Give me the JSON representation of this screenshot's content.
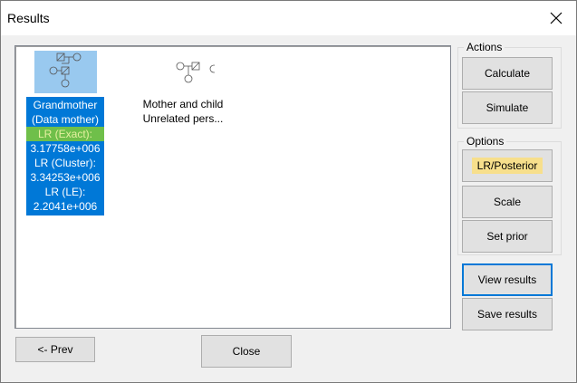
{
  "window": {
    "title": "Results"
  },
  "results_list": {
    "items": [
      {
        "lines": [
          "Grandmother",
          "(Data mother)",
          "LR (Exact):",
          "3.17758e+006",
          "LR (Cluster):",
          "3.34253e+006",
          "LR (LE):",
          "2.2041e+006"
        ],
        "selected": true,
        "highlighted_line": "LR (Exact):"
      },
      {
        "lines": [
          "Mother and child",
          "Unrelated pers..."
        ],
        "selected": false
      }
    ]
  },
  "actions": {
    "legend": "Actions",
    "calculate_label": "Calculate",
    "simulate_label": "Simulate"
  },
  "options": {
    "legend": "Options",
    "lr_posterior_label": "LR/Posterior",
    "scale_label": "Scale",
    "set_prior_label": "Set prior"
  },
  "buttons": {
    "view_results_label": "View results",
    "save_results_label": "Save results",
    "prev_label": "<- Prev",
    "close_label": "Close"
  },
  "colors": {
    "selection": "#0078d7",
    "icon_selection": "#99c9ef",
    "highlight_green": "#6fbf4a",
    "highlight_yellow": "#f7df8c"
  }
}
